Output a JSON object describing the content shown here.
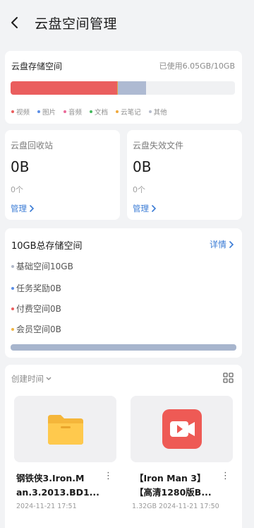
{
  "header": {
    "title": "云盘空间管理"
  },
  "storage": {
    "label": "云盘存储空间",
    "used_text": "已使用6.05GB/10GB",
    "usage": [
      {
        "name": "视频",
        "fraction": 0.474,
        "color": "#ea5e5e"
      },
      {
        "name": "图片",
        "fraction": 0.003,
        "color": "#e2a24a"
      },
      {
        "name": "音频",
        "fraction": 0.128,
        "color": "#aebad2"
      }
    ],
    "legend": [
      {
        "label": "视频",
        "color": "#ea5e5e"
      },
      {
        "label": "图片",
        "color": "#5b8ee6"
      },
      {
        "label": "音频",
        "color": "#ea6b9a"
      },
      {
        "label": "文档",
        "color": "#43b85c"
      },
      {
        "label": "云笔记",
        "color": "#f0a93c"
      },
      {
        "label": "其他",
        "color": "#b6bccb"
      }
    ]
  },
  "recycle": {
    "label": "云盘回收站",
    "size": "0B",
    "count": "0个",
    "manage": "管理"
  },
  "invalid": {
    "label": "云盘失效文件",
    "size": "0B",
    "count": "0个",
    "manage": "管理"
  },
  "total": {
    "title": "10GB总存储空间",
    "detail": "详情",
    "rows": [
      {
        "label": "基础空间10GB",
        "color": "#b0b8c8"
      },
      {
        "label": "任务奖励0B",
        "color": "#5b8ee6"
      },
      {
        "label": "付费空间0B",
        "color": "#ea5e5e"
      },
      {
        "label": "会员空间0B",
        "color": "#f0b544"
      }
    ]
  },
  "files": {
    "sort_label": "创建时间",
    "items": [
      {
        "name_line1": "钢铁侠3.Iron.M",
        "name_line2": "an.3.2013.BD1...",
        "meta": "2024-11-21 17:51"
      },
      {
        "name_line1": "【Iron Man 3】",
        "name_line2": "【高清1280版B...",
        "meta": "1.32GB  2024-11-21 17:50"
      }
    ]
  }
}
